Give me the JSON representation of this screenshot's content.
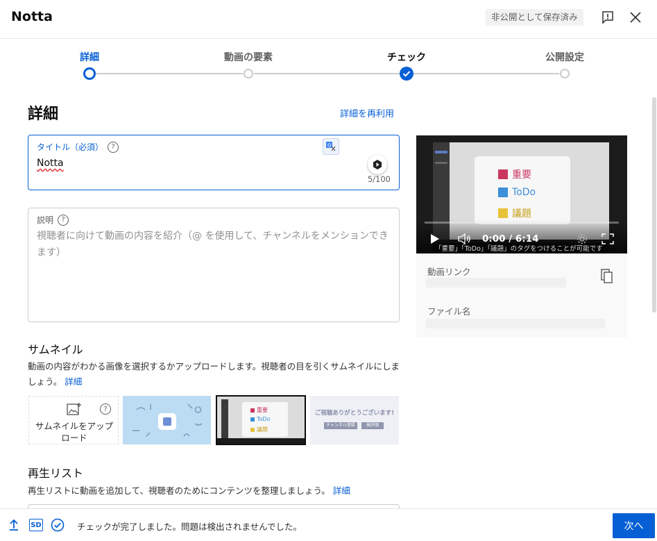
{
  "header": {
    "app_title": "Notta",
    "save_status": "非公開として保存済み"
  },
  "stepper": {
    "steps": [
      {
        "label": "詳細",
        "state": "active"
      },
      {
        "label": "動画の要素",
        "state": "pending"
      },
      {
        "label": "チェック",
        "state": "done"
      },
      {
        "label": "公開設定",
        "state": "pending"
      }
    ]
  },
  "details": {
    "heading": "詳細",
    "reuse_link": "詳細を再利用",
    "title_field": {
      "label": "タイトル（必須）",
      "value": "Notta",
      "counter": "5/100"
    },
    "description_field": {
      "label": "説明",
      "placeholder": "視聴者に向けて動画の内容を紹介（@ を使用して、チャンネルをメンションできます）"
    }
  },
  "preview": {
    "video_time": "0:00 / 6:14",
    "video_tags": [
      "重要",
      "ToDo",
      "議題"
    ],
    "caption": "「重要」「ToDo」「議題」のタグをつけることが可能です",
    "video_link_label": "動画リンク",
    "file_name_label": "ファイル名"
  },
  "thumbnail": {
    "title": "サムネイル",
    "desc": "動画の内容がわかる画像を選択するかアップロードします。視聴者の目を引くサムネイルにしましょう。",
    "link": "詳細",
    "upload_label": "サムネイルをアップロード",
    "thumb3_tags": [
      "重要",
      "ToDo",
      "議題"
    ],
    "thumb4_text": "ご視聴ありがとうございます!",
    "thumb4_buttons": [
      "チャンネル登録",
      "高評価"
    ]
  },
  "playlist": {
    "title": "再生リスト",
    "desc": "再生リストに動画を追加して、視聴者のためにコンテンツを整理しましょう。",
    "link": "詳細"
  },
  "footer": {
    "message": "チェックが完了しました。問題は検出されませんでした。",
    "next_label": "次へ",
    "sd_badge": "SD"
  },
  "colors": {
    "accent": "#065fd4",
    "tag_red": "#c9375f",
    "tag_blue": "#3c8fd8",
    "tag_yellow": "#e7c23b"
  }
}
